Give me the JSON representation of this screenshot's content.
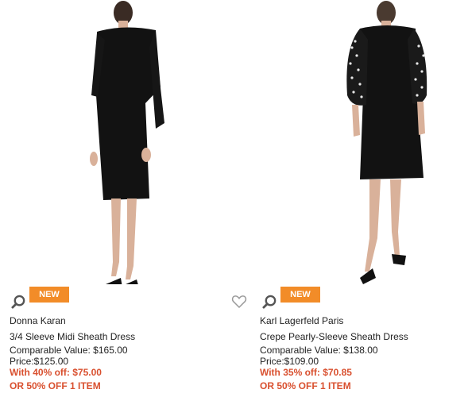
{
  "products": [
    {
      "badge": "NEW",
      "brand": "Donna Karan",
      "name": "3/4 Sleeve Midi Sheath Dress",
      "comparable": "Comparable Value: $165.00",
      "price": "Price:$125.00",
      "sale": "With 40% off: $75.00",
      "extra": "OR 50% OFF 1 ITEM"
    },
    {
      "badge": "NEW",
      "brand": "Karl Lagerfeld Paris",
      "name": "Crepe Pearly-Sleeve Sheath Dress",
      "comparable": "Comparable Value: $138.00",
      "price": "Price:$109.00",
      "sale": "With 35% off: $70.85",
      "extra": "OR 50% OFF 1 ITEM"
    }
  ],
  "icons": {
    "zoom": "magnifier-icon",
    "heart": "heart-outline-icon"
  },
  "colors": {
    "badge": "#f28c28",
    "sale": "#d9502f"
  }
}
